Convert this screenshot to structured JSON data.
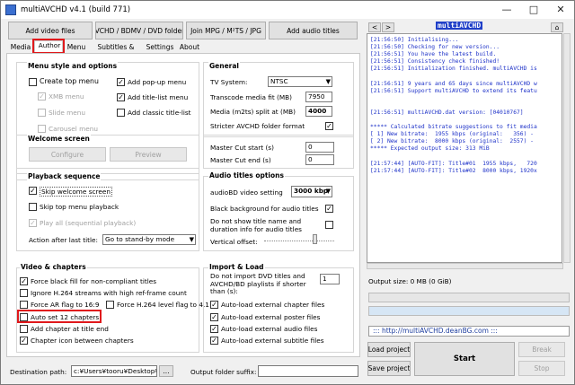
{
  "window": {
    "title": "multiAVCHD v4.1 (build 771)"
  },
  "toolbar": {
    "add_video": "Add video files",
    "avchd": "AVCHD / BDMV / DVD folders",
    "join": "Join MPG / M²TS / JPG",
    "audio": "Add audio titles"
  },
  "tabs": [
    "Media",
    "Author",
    "Menu",
    "Subtitles & Audio",
    "Settings",
    "About"
  ],
  "menu_style": {
    "title": "Menu style and options",
    "create_top": "Create top menu",
    "xmb": "XMB menu",
    "slide": "Slide menu",
    "carousel": "Carousel menu",
    "popup": "Add pop-up menu",
    "titlelist": "Add title-list menu",
    "classic": "Add classic title-list"
  },
  "general": {
    "title": "General",
    "tv_system_label": "TV System:",
    "tv_system_value": "NTSC",
    "transcode_label": "Transcode media fit (MB)",
    "transcode_value": "7950",
    "split_label": "Media (m2ts) split at (MB)",
    "split_value": "4000",
    "stricter": "Stricter AVCHD folder format"
  },
  "welcome": {
    "title": "Welcome screen",
    "configure": "Configure",
    "preview": "Preview"
  },
  "cut": {
    "start_label": "Master Cut start (s)",
    "start_value": "0",
    "end_label": "Master Cut end (s)",
    "end_value": "0"
  },
  "playback": {
    "title": "Playback sequence",
    "skip_welcome": "Skip welcome screen",
    "skip_top": "Skip top menu playback",
    "play_all": "Play all (sequential playback)",
    "action_label": "Action after last title:",
    "action_value": "Go to stand-by mode"
  },
  "audio_opts": {
    "title": "Audio titles options",
    "bitrate_label": "audioBD video setting",
    "bitrate_value": "3000 kbp",
    "black_bg": "Black background for audio titles",
    "no_show": "Do not show title name and duration info for audio titles",
    "vertical": "Vertical offset:"
  },
  "video": {
    "title": "Video & chapters",
    "force_black": "Force black fill for non-compliant titles",
    "ignore": "Ignore H.264 streams with high ref-frame count",
    "force_ar": "Force AR flag to 16:9",
    "force_level": "Force H.264 level flag to 4.1",
    "auto_set": "Auto set 12 chapters",
    "add_chapter": "Add chapter at title end",
    "chapter_icon": "Chapter icon between chapters"
  },
  "import": {
    "title": "Import & Load",
    "no_import": "Do not import DVD titles and AVCHD/BD playlists if shorter than (s):",
    "no_import_value": "1",
    "chapter_files": "Auto-load external chapter files",
    "poster_files": "Auto-load external poster files",
    "audio_files": "Auto-load external audio files",
    "subtitle_files": "Auto-load external subtitle files"
  },
  "bottom": {
    "dest_label": "Destination path:",
    "dest_value": "c:¥Users¥tooru¥Desktop¥AVCH",
    "browse": "...",
    "suffix_label": "Output folder suffix:"
  },
  "right": {
    "nav_prev": "<",
    "nav_next": ">",
    "brand": "multiAVCHD",
    "log": [
      {
        "t": "[21:56:50] Initialising...",
        "c": "b"
      },
      {
        "t": "[21:56:50] Checking for new version...",
        "c": "b"
      },
      {
        "t": "[21:56:51] You have the latest build.",
        "c": "b"
      },
      {
        "t": "[21:56:51] Consistency check finished!",
        "c": "b"
      },
      {
        "t": "[21:56:51] Initialization finished. multiAVCHD is",
        "c": "b"
      },
      {
        "t": "",
        "c": "b"
      },
      {
        "t": "[21:56:51] 9 years and 65 days since multiAVCHD w",
        "c": "b"
      },
      {
        "t": "[21:56:51] Support multiAVCHD to extend its featu",
        "c": "b"
      },
      {
        "t": "",
        "c": "b"
      },
      {
        "t": "",
        "c": "b"
      },
      {
        "t": "[21:56:51] multiAVCHD.dat version: [04010767]",
        "c": "b"
      },
      {
        "t": "",
        "c": "b"
      },
      {
        "t": "***** Calculated bitrate suggestions to fit media",
        "c": "b"
      },
      {
        "t": "[ 1] New bitrate:  1955 kbps (original:   356) - ",
        "c": "b"
      },
      {
        "t": "[ 2] New bitrate:  8000 kbps (original:  2557) - ",
        "c": "b"
      },
      {
        "t": "***** Expected output size: 313 MiB",
        "c": "b"
      },
      {
        "t": "",
        "c": "b"
      },
      {
        "t": "[21:57:44] [AUTO-FIT]: Title#01  1955 kbps,   720",
        "c": "b"
      },
      {
        "t": "[21:57:44] [AUTO-FIT]: Title#02  8000 kbps, 1920x",
        "c": "b"
      }
    ],
    "output_size": "Output size: 0 MB (0 GiB)",
    "url": "::: http://multiAVCHD.deanBG.com :::",
    "load_project": "Load project",
    "save_project": "Save project",
    "start": "Start",
    "break": "Break",
    "stop": "Stop"
  }
}
